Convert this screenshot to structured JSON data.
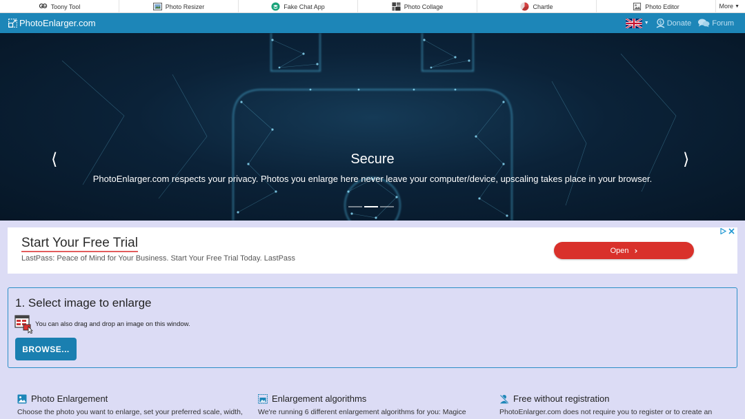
{
  "topbar": {
    "tools": [
      {
        "label": "Toony Tool",
        "icon": "toony-icon"
      },
      {
        "label": "Photo Resizer",
        "icon": "photo-resizer-icon"
      },
      {
        "label": "Fake Chat App",
        "icon": "chat-app-icon"
      },
      {
        "label": "Photo Collage",
        "icon": "collage-icon"
      },
      {
        "label": "Chartle",
        "icon": "chartle-icon"
      },
      {
        "label": "Photo Editor",
        "icon": "photo-editor-icon"
      }
    ],
    "more_label": "More"
  },
  "navbar": {
    "brand": "PhotoEnlarger.com",
    "donate_label": "Donate",
    "forum_label": "Forum",
    "language_flag": "uk-flag-icon"
  },
  "hero": {
    "title": "Secure",
    "subtitle": "PhotoEnlarger.com respects your privacy. Photos you enlarge here never leave your computer/device, upscaling takes place in your browser.",
    "slides_count": 3,
    "active_slide": 2
  },
  "ad": {
    "title": "Start Your Free Trial",
    "text": "LastPass: Peace of Mind for Your Business. Start Your Free Trial Today. LastPass",
    "button_label": "Open"
  },
  "select": {
    "heading": "1. Select image to enlarge",
    "drag_hint": "You can also drag and drop an image on this window.",
    "browse_label": "BROWSE..."
  },
  "features": [
    {
      "title": "Photo Enlargement",
      "text": "Choose the photo you want to enlarge, set your preferred scale, width,"
    },
    {
      "title": "Enlargement algorithms",
      "text": "We're running 6 different enlargement algorithms for you: Magice"
    },
    {
      "title": "Free without registration",
      "text": "PhotoEnlarger.com does not require you to register or to create an"
    }
  ],
  "colors": {
    "navbar": "#1d86b8",
    "panel_border": "#2b8ec7",
    "browse_button": "#1a7fb0",
    "ad_button": "#d9312b",
    "page_background": "#dcdcf5"
  }
}
